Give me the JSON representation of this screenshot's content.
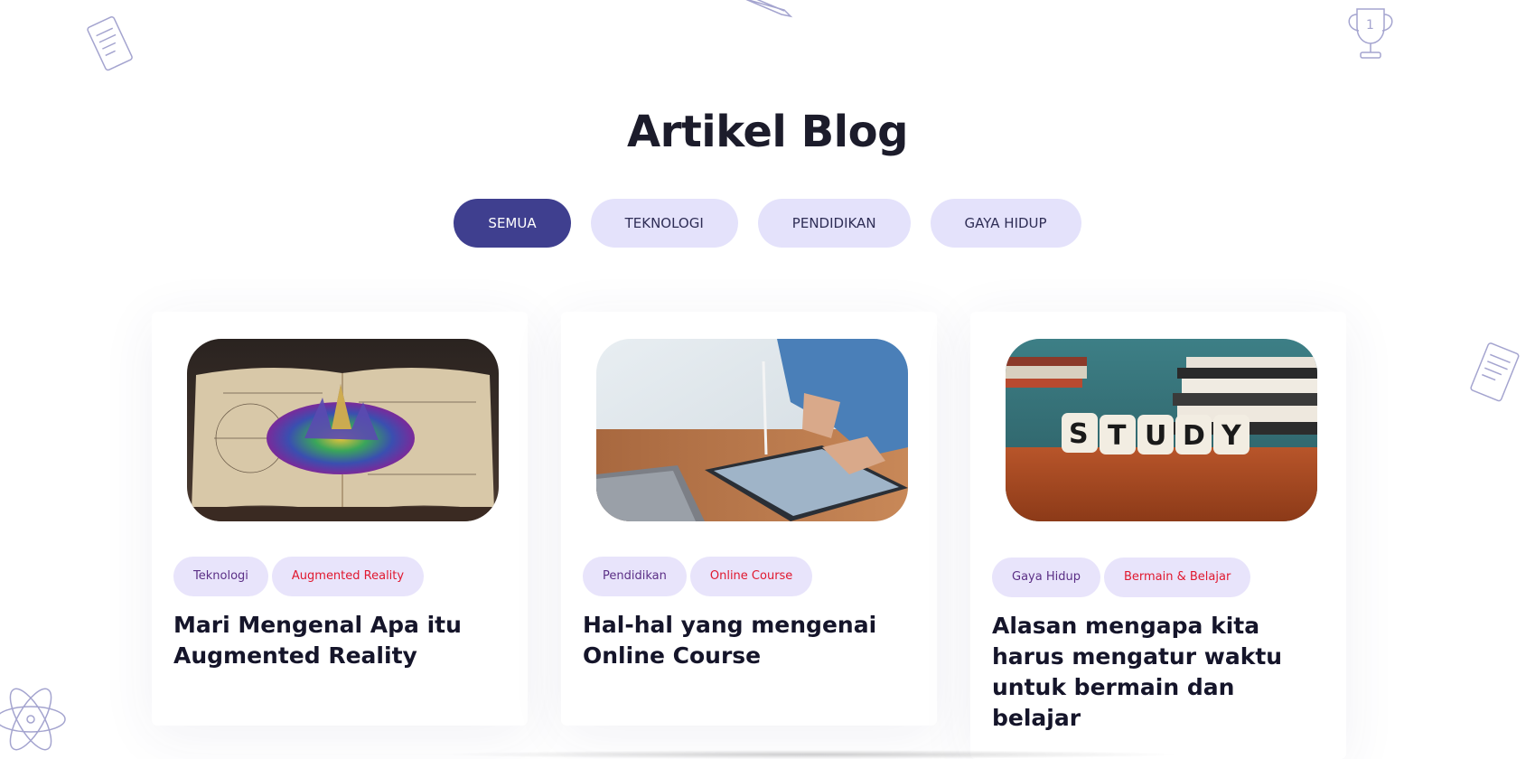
{
  "section": {
    "title": "Artikel Blog"
  },
  "filters": [
    {
      "label": "SEMUA",
      "active": true
    },
    {
      "label": "TEKNOLOGI",
      "active": false
    },
    {
      "label": "PENDIDIKAN",
      "active": false
    },
    {
      "label": "GAYA HIDUP",
      "active": false
    }
  ],
  "articles": [
    {
      "image": "augmented-reality-book-image",
      "tags": [
        "Teknologi",
        "Augmented Reality"
      ],
      "title": "Mari Mengenal Apa itu Augmented Reality"
    },
    {
      "image": "tablet-stylus-image",
      "tags": [
        "Pendidikan",
        "Online Course"
      ],
      "title": "Hal-hal yang mengenai Online Course"
    },
    {
      "image": "study-dice-books-image",
      "study_word": "STUDY",
      "tags": [
        "Gaya Hidup",
        "Bermain & Belajar"
      ],
      "title": "Alasan mengapa kita harus mengatur waktu untuk bermain dan belajar"
    }
  ],
  "colors": {
    "accent": "#3f3f8f",
    "pill": "#e4e2fb",
    "tag_text": "#5b2f86",
    "tag_highlight": "#e0182f"
  }
}
